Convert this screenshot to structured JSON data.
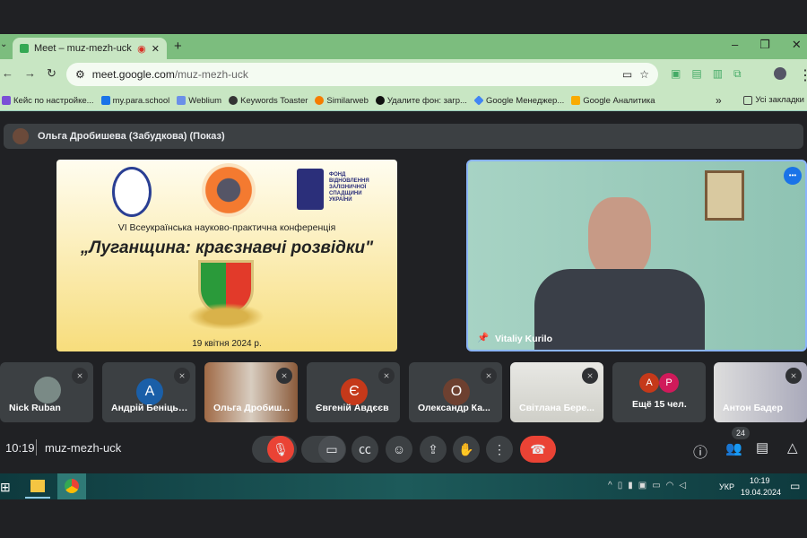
{
  "browser": {
    "tab_title": "Meet – muz-mezh-uck",
    "new_tab": "+",
    "url_host": "meet.google.com",
    "url_path": "/muz-mezh-uck",
    "bookmarks": [
      "Кейс по настройке...",
      "my.para.school",
      "Weblium",
      "Keywords Toaster",
      "Similarweb",
      "Удалите фон: загр...",
      "Google Менеджер...",
      "Google Аналитика"
    ],
    "more": "»",
    "all_bookmarks": "Усі закладки"
  },
  "meet": {
    "presenter": "Ольга Дробишева (Забудкова) (Показ)",
    "slide": {
      "org_name": "ФОНД ВІДНОВЛЕННЯ ЗАЛІЗНИЧНОЇ СПАДЩИНИ УКРАЇНИ",
      "subtitle": "VI Всеукраїнська науково-практична конференція",
      "title": "„Луганщина: краєзнавчі розвідки\"",
      "date": "19 квітня 2024 р."
    },
    "speaker": "Vitaliy Kurilo",
    "participants": [
      {
        "name": "Nick Ruban",
        "type": "photo"
      },
      {
        "name": "Андрій Беніцьк...",
        "initial": "А",
        "color": "#1a5fa8"
      },
      {
        "name": "Ольга Дробиш...",
        "type": "photo"
      },
      {
        "name": "Євгеній Авдєєв",
        "initial": "Є",
        "color": "#c5391a"
      },
      {
        "name": "Олександр Ка...",
        "initial": "О",
        "color": "#6d4030"
      },
      {
        "name": "Світлана Бере...",
        "type": "photo"
      },
      {
        "name": "Ещё 15 чел.",
        "initials": [
          "А",
          "Р"
        ]
      },
      {
        "name": "Антон Бадер",
        "type": "photo"
      }
    ],
    "time": "10:19",
    "code": "muz-mezh-uck",
    "people_count": "24"
  },
  "taskbar": {
    "lang": "УКР",
    "time": "10:19",
    "date": "19.04.2024"
  },
  "colors": {
    "end_call": "#ea4335",
    "accent": "#8ab4f8"
  }
}
